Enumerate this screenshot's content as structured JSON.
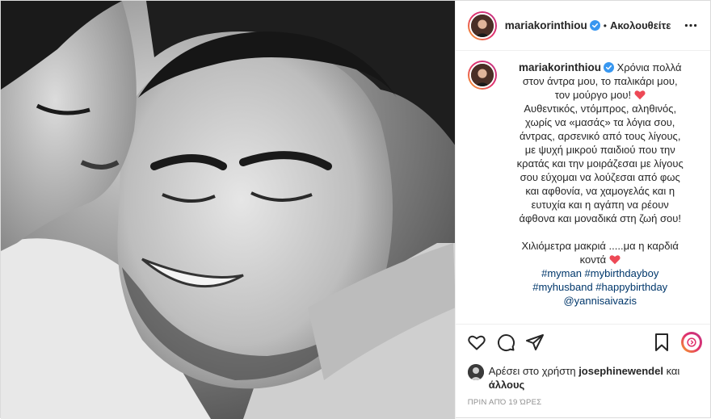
{
  "post": {
    "username": "mariakorinthiou",
    "follow_label": "Ακολουθείτε",
    "separator": "•"
  },
  "caption": {
    "username": "mariakorinthiou",
    "lines": [
      "Χρόνια πολλά",
      "στον άντρα μου, το παλικάρι μου,",
      "τον μούργο μου!",
      "Αυθεντικός, ντόμπρος, αληθινός,",
      "χωρίς να «μασάς» τα λόγια σου,",
      "άντρας, αρσενικό από τους λίγους,",
      "με ψυχή μικρού παιδιού που την",
      "κρατάς και την μοιράζεσαι με λίγους",
      "σου εύχομαι να λούζεσαι από φως",
      "και αφθονία, να χαμογελάς και η",
      "ευτυχία και η αγάπη να ρέουν",
      "άφθονα και μοναδικά στη ζωή σου!",
      "Χιλιόμετρα μακριά .....μα η καρδιά",
      "κοντά"
    ],
    "hashtags": [
      "#myman #mybirthdayboy",
      "#myhusband #happybirthday",
      "@yannisaivazis"
    ]
  },
  "likes": {
    "prefix": "Αρέσει στο χρήστη",
    "user": "josephinewendel",
    "suffix": "και",
    "others": "άλλους"
  },
  "timestamp": "ΠΡΙΝ ΑΠΌ 19 ΏΡΕΣ",
  "colors": {
    "verified": "#3897f0",
    "heart": "#ed4956",
    "link": "#00376b",
    "muted": "#8e8e8e"
  },
  "icons": [
    "verified-badge-icon",
    "more-options-icon",
    "heart-icon",
    "comment-icon",
    "share-icon",
    "bookmark-icon",
    "reels-icon",
    "red-heart-emoji"
  ]
}
